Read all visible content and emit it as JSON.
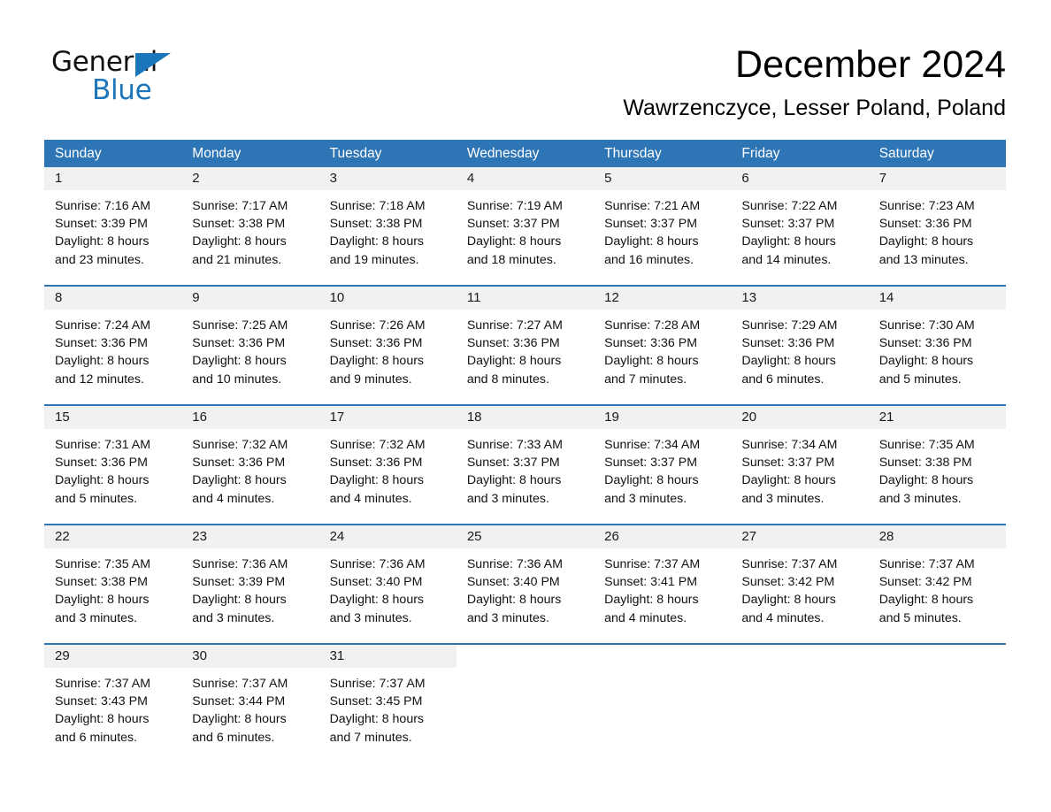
{
  "brand": {
    "name_part1": "General",
    "name_part2": "Blue",
    "accent_color": "#1b75bb"
  },
  "header": {
    "month_title": "December 2024",
    "location": "Wawrzenczyce, Lesser Poland, Poland"
  },
  "theme": {
    "header_blue": "#2e75b6",
    "daynum_band": "#f1f1f1",
    "text": "#111111"
  },
  "weekdays": [
    "Sunday",
    "Monday",
    "Tuesday",
    "Wednesday",
    "Thursday",
    "Friday",
    "Saturday"
  ],
  "weeks": [
    {
      "days": [
        {
          "num": "1",
          "sunrise": "Sunrise: 7:16 AM",
          "sunset": "Sunset: 3:39 PM",
          "daylight1": "Daylight: 8 hours",
          "daylight2": "and 23 minutes."
        },
        {
          "num": "2",
          "sunrise": "Sunrise: 7:17 AM",
          "sunset": "Sunset: 3:38 PM",
          "daylight1": "Daylight: 8 hours",
          "daylight2": "and 21 minutes."
        },
        {
          "num": "3",
          "sunrise": "Sunrise: 7:18 AM",
          "sunset": "Sunset: 3:38 PM",
          "daylight1": "Daylight: 8 hours",
          "daylight2": "and 19 minutes."
        },
        {
          "num": "4",
          "sunrise": "Sunrise: 7:19 AM",
          "sunset": "Sunset: 3:37 PM",
          "daylight1": "Daylight: 8 hours",
          "daylight2": "and 18 minutes."
        },
        {
          "num": "5",
          "sunrise": "Sunrise: 7:21 AM",
          "sunset": "Sunset: 3:37 PM",
          "daylight1": "Daylight: 8 hours",
          "daylight2": "and 16 minutes."
        },
        {
          "num": "6",
          "sunrise": "Sunrise: 7:22 AM",
          "sunset": "Sunset: 3:37 PM",
          "daylight1": "Daylight: 8 hours",
          "daylight2": "and 14 minutes."
        },
        {
          "num": "7",
          "sunrise": "Sunrise: 7:23 AM",
          "sunset": "Sunset: 3:36 PM",
          "daylight1": "Daylight: 8 hours",
          "daylight2": "and 13 minutes."
        }
      ]
    },
    {
      "days": [
        {
          "num": "8",
          "sunrise": "Sunrise: 7:24 AM",
          "sunset": "Sunset: 3:36 PM",
          "daylight1": "Daylight: 8 hours",
          "daylight2": "and 12 minutes."
        },
        {
          "num": "9",
          "sunrise": "Sunrise: 7:25 AM",
          "sunset": "Sunset: 3:36 PM",
          "daylight1": "Daylight: 8 hours",
          "daylight2": "and 10 minutes."
        },
        {
          "num": "10",
          "sunrise": "Sunrise: 7:26 AM",
          "sunset": "Sunset: 3:36 PM",
          "daylight1": "Daylight: 8 hours",
          "daylight2": "and 9 minutes."
        },
        {
          "num": "11",
          "sunrise": "Sunrise: 7:27 AM",
          "sunset": "Sunset: 3:36 PM",
          "daylight1": "Daylight: 8 hours",
          "daylight2": "and 8 minutes."
        },
        {
          "num": "12",
          "sunrise": "Sunrise: 7:28 AM",
          "sunset": "Sunset: 3:36 PM",
          "daylight1": "Daylight: 8 hours",
          "daylight2": "and 7 minutes."
        },
        {
          "num": "13",
          "sunrise": "Sunrise: 7:29 AM",
          "sunset": "Sunset: 3:36 PM",
          "daylight1": "Daylight: 8 hours",
          "daylight2": "and 6 minutes."
        },
        {
          "num": "14",
          "sunrise": "Sunrise: 7:30 AM",
          "sunset": "Sunset: 3:36 PM",
          "daylight1": "Daylight: 8 hours",
          "daylight2": "and 5 minutes."
        }
      ]
    },
    {
      "days": [
        {
          "num": "15",
          "sunrise": "Sunrise: 7:31 AM",
          "sunset": "Sunset: 3:36 PM",
          "daylight1": "Daylight: 8 hours",
          "daylight2": "and 5 minutes."
        },
        {
          "num": "16",
          "sunrise": "Sunrise: 7:32 AM",
          "sunset": "Sunset: 3:36 PM",
          "daylight1": "Daylight: 8 hours",
          "daylight2": "and 4 minutes."
        },
        {
          "num": "17",
          "sunrise": "Sunrise: 7:32 AM",
          "sunset": "Sunset: 3:36 PM",
          "daylight1": "Daylight: 8 hours",
          "daylight2": "and 4 minutes."
        },
        {
          "num": "18",
          "sunrise": "Sunrise: 7:33 AM",
          "sunset": "Sunset: 3:37 PM",
          "daylight1": "Daylight: 8 hours",
          "daylight2": "and 3 minutes."
        },
        {
          "num": "19",
          "sunrise": "Sunrise: 7:34 AM",
          "sunset": "Sunset: 3:37 PM",
          "daylight1": "Daylight: 8 hours",
          "daylight2": "and 3 minutes."
        },
        {
          "num": "20",
          "sunrise": "Sunrise: 7:34 AM",
          "sunset": "Sunset: 3:37 PM",
          "daylight1": "Daylight: 8 hours",
          "daylight2": "and 3 minutes."
        },
        {
          "num": "21",
          "sunrise": "Sunrise: 7:35 AM",
          "sunset": "Sunset: 3:38 PM",
          "daylight1": "Daylight: 8 hours",
          "daylight2": "and 3 minutes."
        }
      ]
    },
    {
      "days": [
        {
          "num": "22",
          "sunrise": "Sunrise: 7:35 AM",
          "sunset": "Sunset: 3:38 PM",
          "daylight1": "Daylight: 8 hours",
          "daylight2": "and 3 minutes."
        },
        {
          "num": "23",
          "sunrise": "Sunrise: 7:36 AM",
          "sunset": "Sunset: 3:39 PM",
          "daylight1": "Daylight: 8 hours",
          "daylight2": "and 3 minutes."
        },
        {
          "num": "24",
          "sunrise": "Sunrise: 7:36 AM",
          "sunset": "Sunset: 3:40 PM",
          "daylight1": "Daylight: 8 hours",
          "daylight2": "and 3 minutes."
        },
        {
          "num": "25",
          "sunrise": "Sunrise: 7:36 AM",
          "sunset": "Sunset: 3:40 PM",
          "daylight1": "Daylight: 8 hours",
          "daylight2": "and 3 minutes."
        },
        {
          "num": "26",
          "sunrise": "Sunrise: 7:37 AM",
          "sunset": "Sunset: 3:41 PM",
          "daylight1": "Daylight: 8 hours",
          "daylight2": "and 4 minutes."
        },
        {
          "num": "27",
          "sunrise": "Sunrise: 7:37 AM",
          "sunset": "Sunset: 3:42 PM",
          "daylight1": "Daylight: 8 hours",
          "daylight2": "and 4 minutes."
        },
        {
          "num": "28",
          "sunrise": "Sunrise: 7:37 AM",
          "sunset": "Sunset: 3:42 PM",
          "daylight1": "Daylight: 8 hours",
          "daylight2": "and 5 minutes."
        }
      ]
    },
    {
      "days": [
        {
          "num": "29",
          "sunrise": "Sunrise: 7:37 AM",
          "sunset": "Sunset: 3:43 PM",
          "daylight1": "Daylight: 8 hours",
          "daylight2": "and 6 minutes."
        },
        {
          "num": "30",
          "sunrise": "Sunrise: 7:37 AM",
          "sunset": "Sunset: 3:44 PM",
          "daylight1": "Daylight: 8 hours",
          "daylight2": "and 6 minutes."
        },
        {
          "num": "31",
          "sunrise": "Sunrise: 7:37 AM",
          "sunset": "Sunset: 3:45 PM",
          "daylight1": "Daylight: 8 hours",
          "daylight2": "and 7 minutes."
        },
        {
          "num": "",
          "sunrise": "",
          "sunset": "",
          "daylight1": "",
          "daylight2": ""
        },
        {
          "num": "",
          "sunrise": "",
          "sunset": "",
          "daylight1": "",
          "daylight2": ""
        },
        {
          "num": "",
          "sunrise": "",
          "sunset": "",
          "daylight1": "",
          "daylight2": ""
        },
        {
          "num": "",
          "sunrise": "",
          "sunset": "",
          "daylight1": "",
          "daylight2": ""
        }
      ]
    }
  ]
}
